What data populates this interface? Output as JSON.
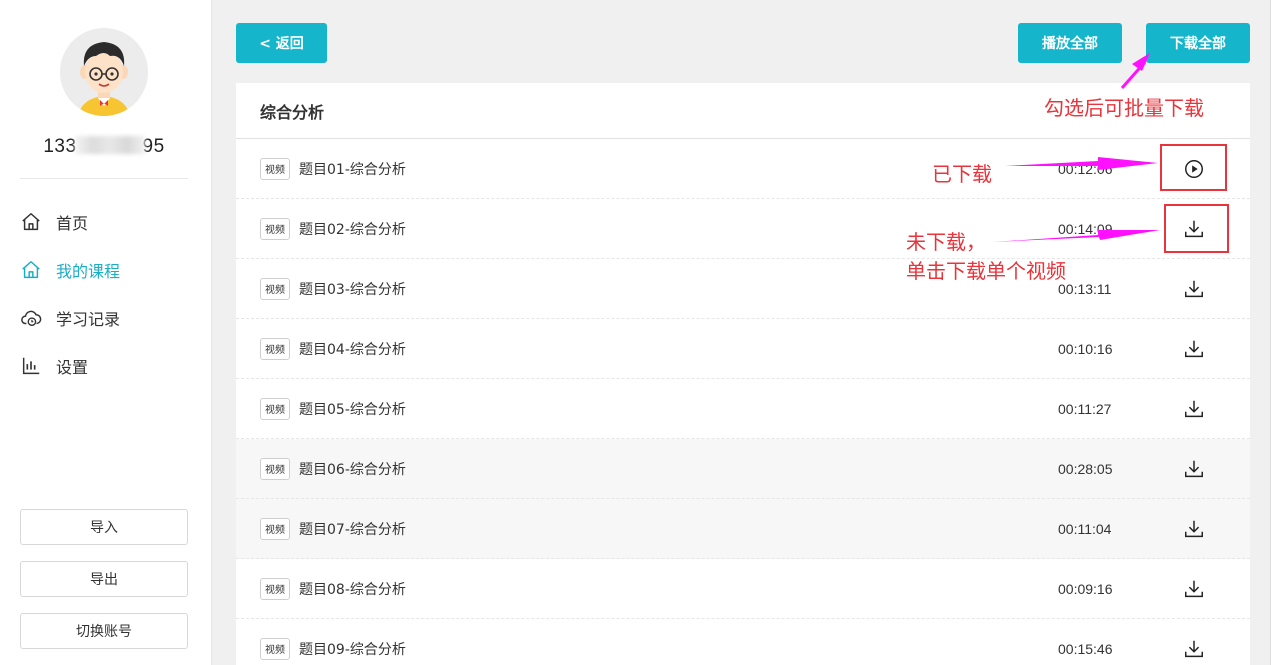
{
  "user": {
    "phone_prefix": "133",
    "phone_suffix": "95"
  },
  "nav": {
    "home": "首页",
    "my_courses": "我的课程",
    "study_records": "学习记录",
    "settings": "设置"
  },
  "sidebar_buttons": {
    "import": "导入",
    "export": "导出",
    "switch_account": "切换账号"
  },
  "toolbar": {
    "back": "< 返回",
    "play_all": "播放全部",
    "download_all": "下载全部"
  },
  "course": {
    "title": "综合分析",
    "items": [
      {
        "tag": "视频",
        "title": "题目01-综合分析",
        "duration": "00:12:06",
        "status": "downloaded",
        "icon": "play-circle-icon"
      },
      {
        "tag": "视频",
        "title": "题目02-综合分析",
        "duration": "00:14:09",
        "status": "not-downloaded",
        "icon": "download-icon"
      },
      {
        "tag": "视频",
        "title": "题目03-综合分析",
        "duration": "00:13:11",
        "status": "not-downloaded",
        "icon": "download-icon"
      },
      {
        "tag": "视频",
        "title": "题目04-综合分析",
        "duration": "00:10:16",
        "status": "not-downloaded",
        "icon": "download-icon"
      },
      {
        "tag": "视频",
        "title": "题目05-综合分析",
        "duration": "00:11:27",
        "status": "not-downloaded",
        "icon": "download-icon"
      },
      {
        "tag": "视频",
        "title": "题目06-综合分析",
        "duration": "00:28:05",
        "status": "not-downloaded",
        "icon": "download-icon"
      },
      {
        "tag": "视频",
        "title": "题目07-综合分析",
        "duration": "00:11:04",
        "status": "not-downloaded",
        "icon": "download-icon"
      },
      {
        "tag": "视频",
        "title": "题目08-综合分析",
        "duration": "00:09:16",
        "status": "not-downloaded",
        "icon": "download-icon"
      },
      {
        "tag": "视频",
        "title": "题目09-综合分析",
        "duration": "00:15:46",
        "status": "not-downloaded",
        "icon": "download-icon"
      }
    ]
  },
  "annotations": {
    "batch": "勾选后可批量下载",
    "downloaded": "已下载",
    "not_downloaded_line1": "未下载，",
    "not_downloaded_line2": "单击下载单个视频"
  },
  "colors": {
    "accent": "#15b5cc",
    "active_nav": "#1aaec6",
    "annotation_red": "#e8343a",
    "arrow_magenta": "#ff10ff"
  }
}
